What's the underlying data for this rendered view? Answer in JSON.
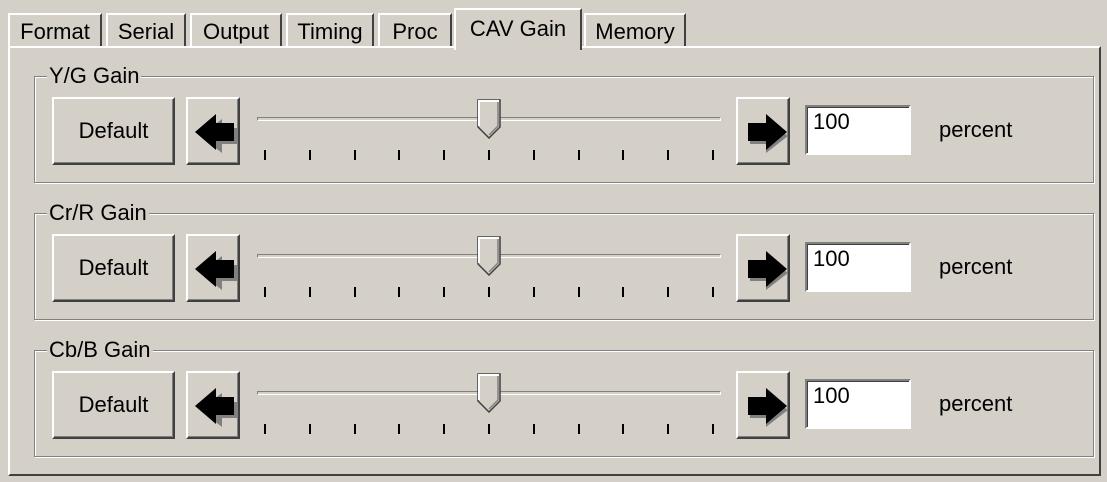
{
  "tabs": [
    {
      "label": "Format",
      "active": false
    },
    {
      "label": "Serial",
      "active": false
    },
    {
      "label": "Output",
      "active": false
    },
    {
      "label": "Timing",
      "active": false
    },
    {
      "label": "Proc",
      "active": false
    },
    {
      "label": "CAV Gain",
      "active": true
    },
    {
      "label": "Memory",
      "active": false
    }
  ],
  "groups": [
    {
      "id": "yg",
      "label": "Y/G Gain",
      "default_label": "Default",
      "value": "100",
      "unit": "percent",
      "slider_position": 0.5
    },
    {
      "id": "crr",
      "label": "Cr/R Gain",
      "default_label": "Default",
      "value": "100",
      "unit": "percent",
      "slider_position": 0.5
    },
    {
      "id": "cbb",
      "label": "Cb/B Gain",
      "default_label": "Default",
      "value": "100",
      "unit": "percent",
      "slider_position": 0.5
    }
  ],
  "icons": {
    "decrease": "left-arrow-icon",
    "increase": "right-arrow-icon"
  },
  "colors": {
    "face": "#d4d0c8",
    "highlight": "#ffffff",
    "shadow": "#808080",
    "dark_shadow": "#404040"
  }
}
